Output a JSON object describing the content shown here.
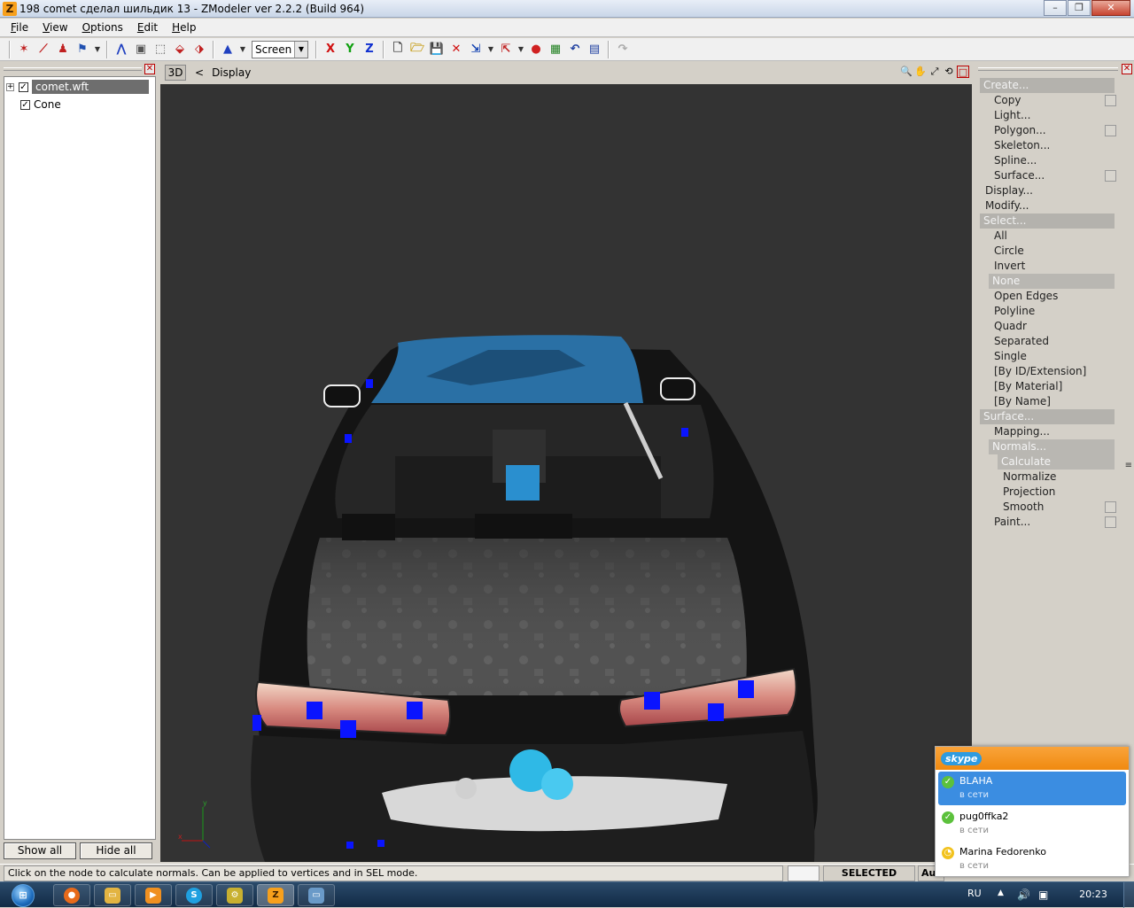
{
  "window": {
    "title": "198 comet сделал шильдик 13 - ZModeler ver 2.2.2 (Build 964)",
    "app_icon": "Z",
    "minimize": "–",
    "restore": "❐",
    "close": "✕"
  },
  "menu": [
    "File",
    "View",
    "Options",
    "Edit",
    "Help"
  ],
  "toolbar": {
    "space_combo": "Screen",
    "axis_x": "X",
    "axis_y": "Y",
    "axis_z": "Z"
  },
  "scene_tree": {
    "close": "✕",
    "items": [
      {
        "label": "comet.wft",
        "checked": true,
        "expand": "+"
      },
      {
        "label": "Cone",
        "checked": true
      }
    ],
    "show_all": "Show all",
    "hide_all": "Hide all"
  },
  "viewport": {
    "mode": "3D",
    "nav_arrow": "<",
    "label": "Display",
    "axis_y": "y",
    "axis_x": "x"
  },
  "commands": {
    "close": "✕",
    "create": "Create...",
    "create_items": [
      "Copy",
      "Light...",
      "Polygon...",
      "Skeleton...",
      "Spline...",
      "Surface..."
    ],
    "display": "Display...",
    "modify": "Modify...",
    "select": "Select...",
    "select_items": [
      "All",
      "Circle",
      "Invert",
      "None",
      "Open Edges",
      "Polyline",
      "Quadr",
      "Separated",
      "Single",
      "[By ID/Extension]",
      "[By Material]",
      "[By Name]"
    ],
    "surface": "Surface...",
    "mapping": "Mapping...",
    "normals": "Normals...",
    "normals_items": [
      "Calculate",
      "Normalize",
      "Projection",
      "Smooth"
    ],
    "paint": "Paint..."
  },
  "status": {
    "message": "Click on the node to calculate normals. Can be applied to vertices and in SEL mode.",
    "mode": "SELECTED MODE",
    "auto": "Au"
  },
  "skype": {
    "logo": "skype",
    "contacts": [
      {
        "name": "BLAHA",
        "status": "в сети"
      },
      {
        "name": "pug0ffka2",
        "status": "в сети"
      },
      {
        "name": "Marina Fedorenko",
        "status": "в сети"
      }
    ]
  },
  "taskbar": {
    "start": "⊞",
    "lang": "RU",
    "clock": "20:23"
  },
  "colors": {
    "viewport_bg": "#333333",
    "selection_gray": "#6e6e6e",
    "skype_orange": "#f08a10",
    "skype_selected": "#3b8de1",
    "vertex_blue": "#0a14ff"
  }
}
